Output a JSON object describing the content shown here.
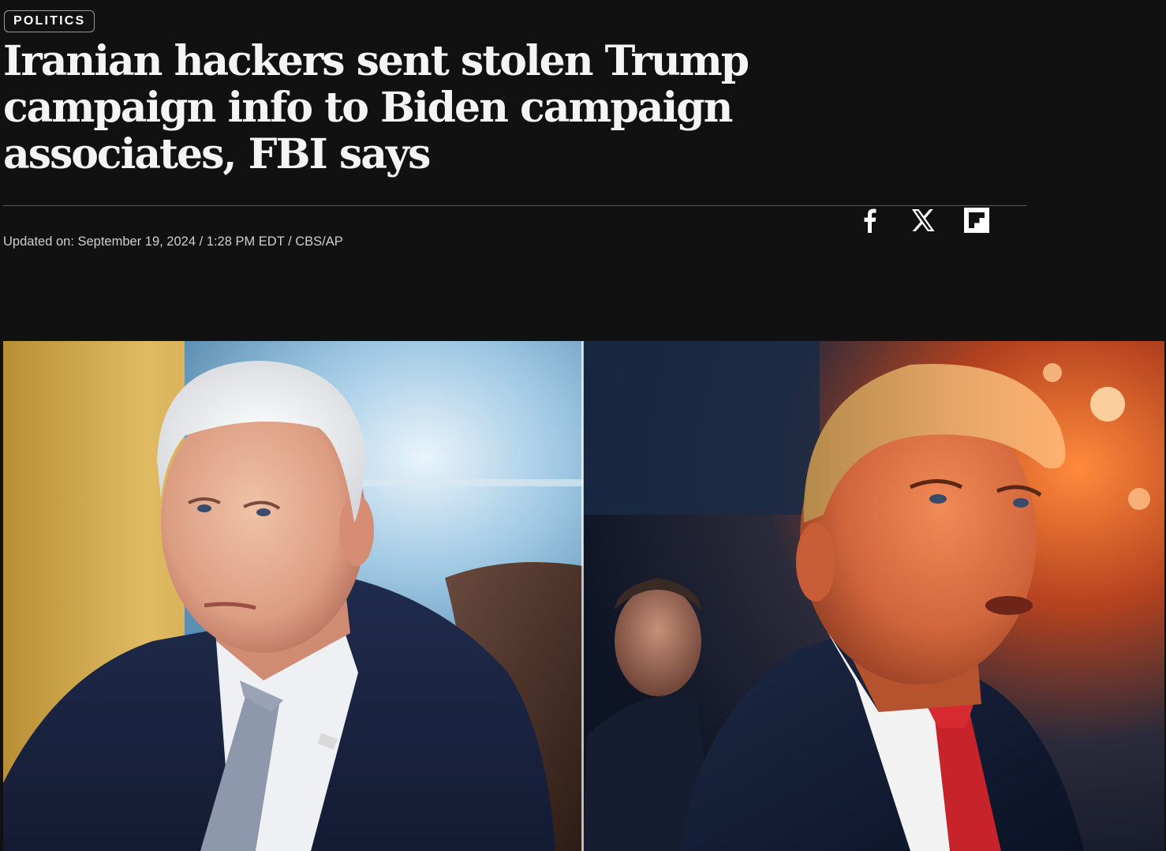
{
  "section": {
    "label": "POLITICS"
  },
  "headline": "Iranian hackers sent stolen Trump campaign info to Biden campaign associates, FBI says",
  "byline": "Updated on: September 19, 2024 / 1:28 PM EDT / CBS/AP",
  "share": {
    "icons": [
      "facebook-icon",
      "x-icon",
      "flipboard-icon"
    ]
  },
  "hero": {
    "left_panel": "photo-left",
    "right_panel": "photo-right"
  },
  "colors": {
    "background": "#111111",
    "headline": "#f4f4f4",
    "byline": "#cfcfcf",
    "divider": "#555555"
  }
}
